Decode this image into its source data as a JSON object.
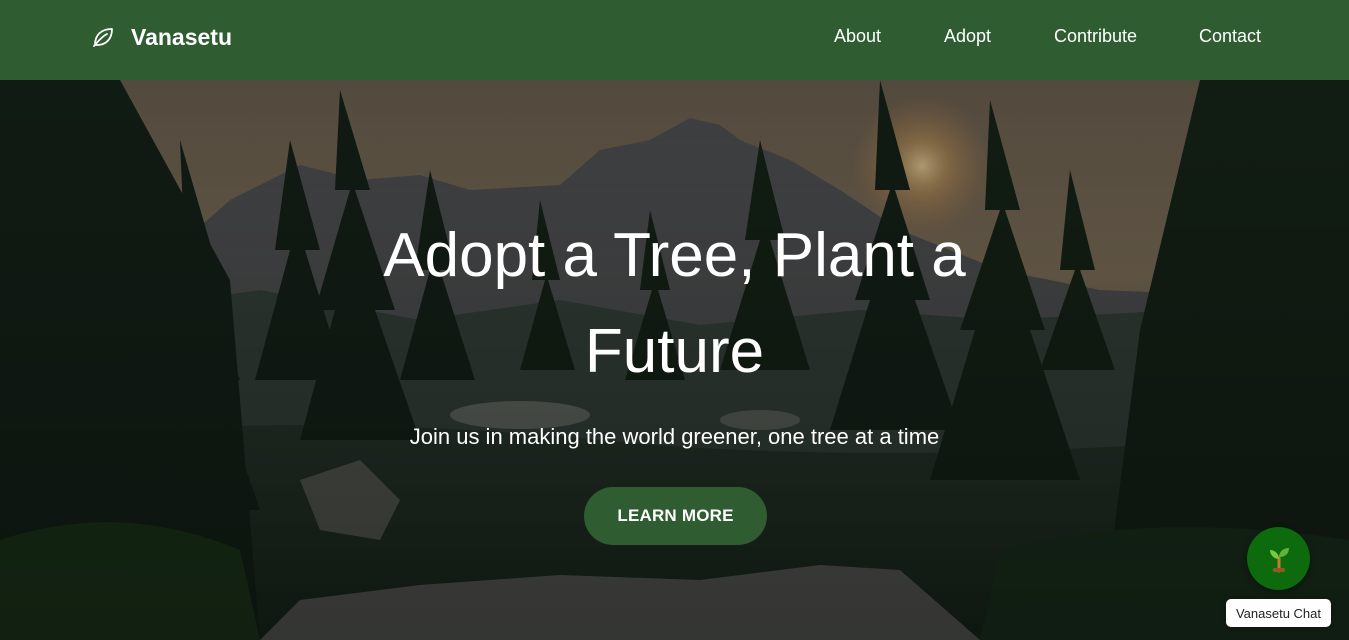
{
  "brand": {
    "name": "Vanasetu",
    "icon": "leaf-icon"
  },
  "nav": {
    "links": [
      {
        "label": "About"
      },
      {
        "label": "Adopt"
      },
      {
        "label": "Contribute"
      },
      {
        "label": "Contact"
      }
    ]
  },
  "hero": {
    "title": "Adopt a Tree, Plant a Future",
    "subtitle": "Join us in making the world greener, one tree at a time",
    "cta_label": "LEARN MORE",
    "background": "forest-mountain-sunset-image"
  },
  "chat": {
    "label": "Vanasetu Chat",
    "icon": "seedling-icon"
  },
  "colors": {
    "nav_bg": "#2f5d31",
    "cta_bg": "#2f5d31",
    "chat_bg": "#0d6b0d",
    "text": "#ffffff"
  }
}
